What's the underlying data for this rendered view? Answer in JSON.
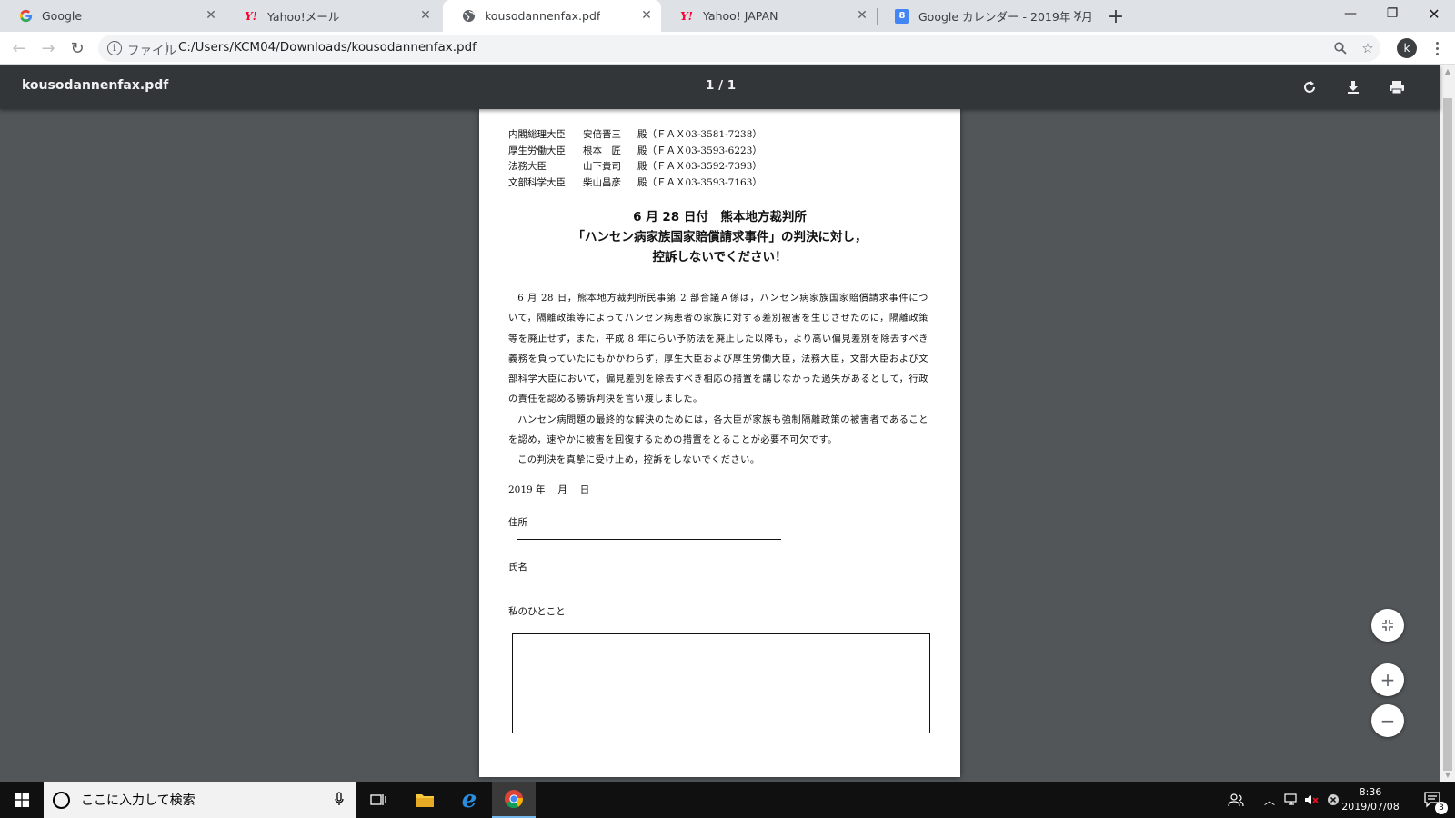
{
  "browser": {
    "tabs": [
      {
        "favicon": "google-g",
        "title": "Google",
        "active": false
      },
      {
        "favicon": "yahoo-y",
        "title": "Yahoo!メール",
        "active": false
      },
      {
        "favicon": "globe",
        "title": "kousodannenfax.pdf",
        "active": true
      },
      {
        "favicon": "yahoo-y",
        "title": "Yahoo! JAPAN",
        "active": false
      },
      {
        "favicon": "calendar-8",
        "title": "Google カレンダー - 2019年 7月",
        "active": false
      }
    ],
    "omnibox": {
      "scheme_label": "ファイル",
      "url": "C:/Users/KCM04/Downloads/kousodannenfax.pdf"
    },
    "profile_initial": "k"
  },
  "pdf_viewer": {
    "title": "kousodannenfax.pdf",
    "page_indicator": "1 / 1"
  },
  "document": {
    "recipients": [
      {
        "role": "内閣総理大臣",
        "name": "安倍晋三",
        "fax": "殿（ＦＡＸ03-3581-7238）"
      },
      {
        "role": "厚生労働大臣",
        "name": "根本　匠",
        "fax": "殿（ＦＡＸ03-3593-6223）"
      },
      {
        "role": "法務大臣",
        "name": "山下貴司",
        "fax": "殿（ＦＡＸ03-3592-7393）"
      },
      {
        "role": "文部科学大臣",
        "name": "柴山昌彦",
        "fax": "殿（ＦＡＸ03-3593-7163）"
      }
    ],
    "headline": [
      "6 月 28 日付　熊本地方裁判所",
      "「ハンセン病家族国家賠償請求事件」の判決に対し，",
      "控訴しないでください！"
    ],
    "paragraphs": [
      "6 月 28 日，熊本地方裁判所民事第 2 部合議Ａ係は，ハンセン病家族国家賠償請求事件について，隔離政策等によってハンセン病患者の家族に対する差別被害を生じさせたのに，隔離政策等を廃止せず，また，平成 8 年にらい予防法を廃止した以降も，より高い偏見差別を除去すべき義務を負っていたにもかかわらず，厚生大臣および厚生労働大臣，法務大臣，文部大臣および文部科学大臣において，偏見差別を除去すべき相応の措置を講じなかった過失があるとして，行政の責任を認める勝訴判決を言い渡しました。",
      "ハンセン病問題の最終的な解決のためには，各大臣が家族も強制隔離政策の被害者であることを認め，速やかに被害を回復するための措置をとることが必要不可欠です。",
      "この判決を真摯に受け止め，控訴をしないでください。"
    ],
    "date_line": "2019 年　 月　 日",
    "address_label": "住所",
    "name_label": "氏名",
    "comment_label": "私のひとこと"
  },
  "taskbar": {
    "search_placeholder": "ここに入力して検索",
    "clock_time": "8:36",
    "clock_date": "2019/07/08",
    "notification_count": "3"
  },
  "colors": {
    "tabstrip": "#dee1e6",
    "pdf_toolbar": "#323639",
    "viewer_bg": "#525659",
    "yahoo_red": "#ff0033",
    "taskbar": "#101010"
  }
}
